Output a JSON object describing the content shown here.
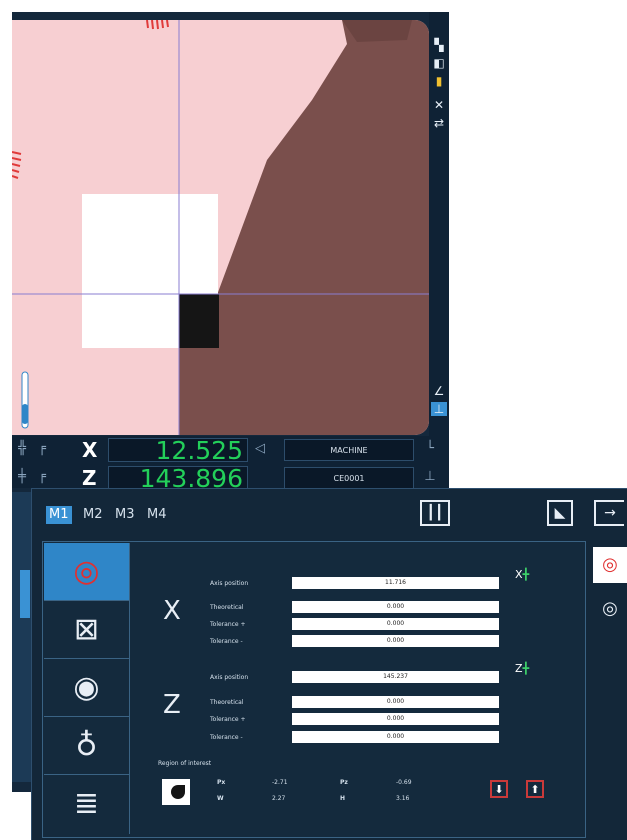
{
  "dro": {
    "x": {
      "axis": "X",
      "value": "12.525",
      "box": "MACHINE"
    },
    "z": {
      "axis": "Z",
      "value": "143.896",
      "box": "CE0001"
    }
  },
  "dialog": {
    "tabs": [
      "M1",
      "M2",
      "M3",
      "M4"
    ],
    "active_tab": "M1",
    "x": {
      "axis": "X",
      "axis_position_label": "Axis position",
      "axis_position": "11.716",
      "theoretical_label": "Theoretical",
      "theoretical": "0.000",
      "tol_plus_label": "Tolerance +",
      "tol_plus": "0.000",
      "tol_minus_label": "Tolerance -",
      "tol_minus": "0.000",
      "marker": "X"
    },
    "z": {
      "axis": "Z",
      "axis_position_label": "Axis position",
      "axis_position": "145.237",
      "theoretical_label": "Theoretical",
      "theoretical": "0.000",
      "tol_plus_label": "Tolerance +",
      "tol_plus": "0.000",
      "tol_minus_label": "Tolerance -",
      "tol_minus": "0.000",
      "marker": "Z"
    },
    "roi": {
      "label": "Region of interest",
      "px_label": "Px",
      "px": "-2.71",
      "w_label": "W",
      "w": "2.27",
      "pz_label": "Pz",
      "pz": "-0.69",
      "h_label": "H",
      "h": "3.16"
    }
  },
  "colors": {
    "accent": "#3a92d4",
    "readout_green": "#23d05a",
    "workpiece": "#7a4f4c",
    "background_pink": "#f7cfd2"
  }
}
